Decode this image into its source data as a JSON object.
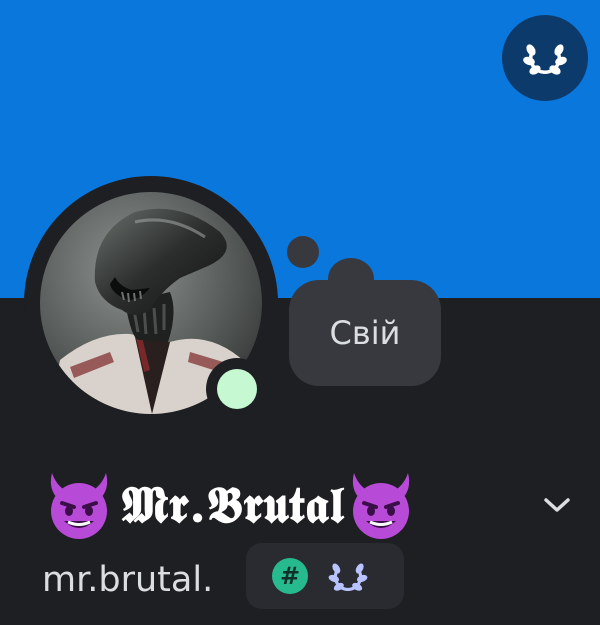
{
  "colors": {
    "banner": "#0a77dc",
    "background": "#1e1f22",
    "nitro_button": "#0c3a6b",
    "status_online": "#c6f8d2",
    "bubble": "#38393f",
    "bubble_text": "#dbdee1",
    "badge_container": "#2a2b30",
    "hash_badge": "#27ba8f",
    "laurel": "#b9c3ff",
    "devil": "#b84ad8"
  },
  "banner": {
    "nitro_icon": "nitro-laurel-icon"
  },
  "profile": {
    "avatar_icon": "alien-portrait-avatar",
    "status": "online",
    "custom_status": "Свій",
    "display_name": "𝕸𝖗.𝕭𝖗𝖚𝖙𝖆𝖑",
    "name_prefix_emoji": "smiling-devil-icon",
    "name_suffix_emoji": "smiling-devil-icon",
    "username": "mr.brutal.",
    "expand_icon": "chevron-down-icon"
  },
  "badges": [
    {
      "icon": "hash-badge-icon",
      "text": "#"
    },
    {
      "icon": "laurel-badge-icon"
    }
  ]
}
